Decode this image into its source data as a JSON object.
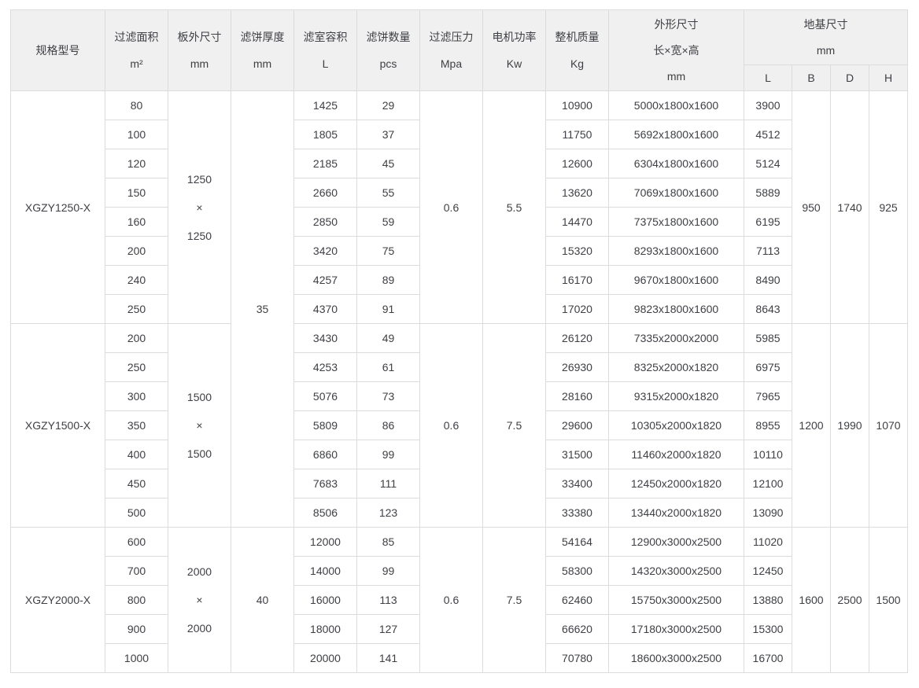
{
  "colors": {
    "header_bg": "#f0f0f0",
    "border": "#dcdcdc",
    "text": "#3f4045",
    "body_bg": "#ffffff"
  },
  "table": {
    "header": {
      "model": {
        "title": "规格型号"
      },
      "area": {
        "title": "过滤面积",
        "unit": "m²"
      },
      "plate": {
        "title": "板外尺寸",
        "unit": "mm"
      },
      "thickness": {
        "title": "滤饼厚度",
        "unit": "mm"
      },
      "volume": {
        "title": "滤室容积",
        "unit": "L"
      },
      "cakes": {
        "title": "滤饼数量",
        "unit": "pcs"
      },
      "pressure": {
        "title": "过滤压力",
        "unit": "Mpa"
      },
      "power": {
        "title": "电机功率",
        "unit": "Kw"
      },
      "weight": {
        "title": "整机质量",
        "unit": "Kg"
      },
      "dimensions": {
        "title": "外形尺寸",
        "subtitle": "长×宽×高",
        "unit": "mm"
      },
      "foundation": {
        "title": "地基尺寸",
        "unit": "mm",
        "sub": [
          "L",
          "B",
          "D",
          "H"
        ]
      }
    },
    "thickness_groups": [
      {
        "value": "35",
        "rows": 15
      },
      {
        "value": "40",
        "rows": 5
      }
    ],
    "blocks": [
      {
        "model": "XGZY1250-X",
        "plate": "1250\n×\n1250",
        "pressure": "0.6",
        "power": "5.5",
        "foundation_b": "950",
        "foundation_d": "1740",
        "foundation_h": "925",
        "rows": [
          {
            "area": "80",
            "volume": "1425",
            "cakes": "29",
            "weight": "10900",
            "dims": "5000x1800x1600",
            "foundation_l": "3900"
          },
          {
            "area": "100",
            "volume": "1805",
            "cakes": "37",
            "weight": "11750",
            "dims": "5692x1800x1600",
            "foundation_l": "4512"
          },
          {
            "area": "120",
            "volume": "2185",
            "cakes": "45",
            "weight": "12600",
            "dims": "6304x1800x1600",
            "foundation_l": "5124"
          },
          {
            "area": "150",
            "volume": "2660",
            "cakes": "55",
            "weight": "13620",
            "dims": "7069x1800x1600",
            "foundation_l": "5889"
          },
          {
            "area": "160",
            "volume": "2850",
            "cakes": "59",
            "weight": "14470",
            "dims": "7375x1800x1600",
            "foundation_l": "6195"
          },
          {
            "area": "200",
            "volume": "3420",
            "cakes": "75",
            "weight": "15320",
            "dims": "8293x1800x1600",
            "foundation_l": "7113"
          },
          {
            "area": "240",
            "volume": "4257",
            "cakes": "89",
            "weight": "16170",
            "dims": "9670x1800x1600",
            "foundation_l": "8490"
          },
          {
            "area": "250",
            "volume": "4370",
            "cakes": "91",
            "weight": "17020",
            "dims": "9823x1800x1600",
            "foundation_l": "8643"
          }
        ]
      },
      {
        "model": "XGZY1500-X",
        "plate": "1500\n×\n1500",
        "pressure": "0.6",
        "power": "7.5",
        "foundation_b": "1200",
        "foundation_d": "1990",
        "foundation_h": "1070",
        "rows": [
          {
            "area": "200",
            "volume": "3430",
            "cakes": "49",
            "weight": "26120",
            "dims": "7335x2000x2000",
            "foundation_l": "5985"
          },
          {
            "area": "250",
            "volume": "4253",
            "cakes": "61",
            "weight": "26930",
            "dims": "8325x2000x1820",
            "foundation_l": "6975"
          },
          {
            "area": "300",
            "volume": "5076",
            "cakes": "73",
            "weight": "28160",
            "dims": "9315x2000x1820",
            "foundation_l": "7965"
          },
          {
            "area": "350",
            "volume": "5809",
            "cakes": "86",
            "weight": "29600",
            "dims": "10305x2000x1820",
            "foundation_l": "8955"
          },
          {
            "area": "400",
            "volume": "6860",
            "cakes": "99",
            "weight": "31500",
            "dims": "11460x2000x1820",
            "foundation_l": "10110"
          },
          {
            "area": "450",
            "volume": "7683",
            "cakes": "111",
            "weight": "33400",
            "dims": "12450x2000x1820",
            "foundation_l": "12100"
          },
          {
            "area": "500",
            "volume": "8506",
            "cakes": "123",
            "weight": "33380",
            "dims": "13440x2000x1820",
            "foundation_l": "13090"
          }
        ]
      },
      {
        "model": "XGZY2000-X",
        "plate": "2000\n×\n2000",
        "pressure": "0.6",
        "power": "7.5",
        "foundation_b": "1600",
        "foundation_d": "2500",
        "foundation_h": "1500",
        "rows": [
          {
            "area": "600",
            "volume": "12000",
            "cakes": "85",
            "weight": "54164",
            "dims": "12900x3000x2500",
            "foundation_l": "11020"
          },
          {
            "area": "700",
            "volume": "14000",
            "cakes": "99",
            "weight": "58300",
            "dims": "14320x3000x2500",
            "foundation_l": "12450"
          },
          {
            "area": "800",
            "volume": "16000",
            "cakes": "113",
            "weight": "62460",
            "dims": "15750x3000x2500",
            "foundation_l": "13880"
          },
          {
            "area": "900",
            "volume": "18000",
            "cakes": "127",
            "weight": "66620",
            "dims": "17180x3000x2500",
            "foundation_l": "15300"
          },
          {
            "area": "1000",
            "volume": "20000",
            "cakes": "141",
            "weight": "70780",
            "dims": "18600x3000x2500",
            "foundation_l": "16700"
          }
        ]
      }
    ]
  }
}
